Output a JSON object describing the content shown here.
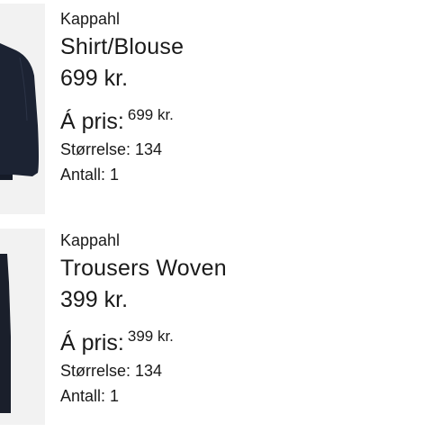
{
  "items": [
    {
      "brand": "Kappahl",
      "name": "Shirt/Blouse",
      "price": "699 kr.",
      "unit_price_label": "Á pris:",
      "unit_price_value": "699 kr.",
      "size": "Størrelse: 134",
      "quantity": "Antall: 1",
      "image_icon": "shirt-thumbnail",
      "image_color": "#1c2333"
    },
    {
      "brand": "Kappahl",
      "name": "Trousers Woven",
      "price": "399 kr.",
      "unit_price_label": "Á pris:",
      "unit_price_value": "399 kr.",
      "size": "Størrelse: 134",
      "quantity": "Antall: 1",
      "image_icon": "trousers-thumbnail",
      "image_color": "#1a1f2b"
    }
  ]
}
